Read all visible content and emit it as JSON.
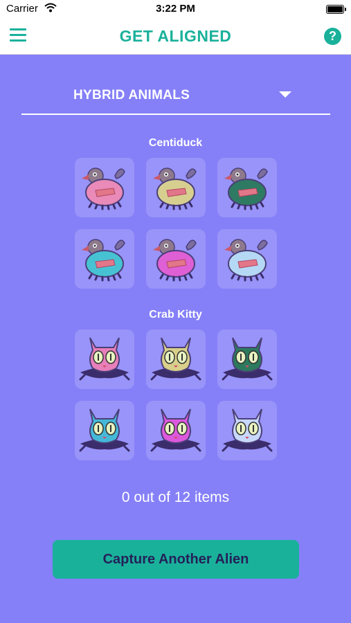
{
  "status_bar": {
    "carrier": "Carrier",
    "time": "3:22 PM"
  },
  "header": {
    "title": "GET ALIGNED",
    "menu_icon": "hamburger-menu-icon",
    "help_icon": "question-circle-icon",
    "help_glyph": "?"
  },
  "category_select": {
    "selected": "HYBRID ANIMALS"
  },
  "groups": [
    {
      "title": "Centiduck",
      "items": [
        {
          "kind": "duck",
          "color": "#e98ab8"
        },
        {
          "kind": "duck",
          "color": "#d7cf90"
        },
        {
          "kind": "duck",
          "color": "#2f7a62"
        },
        {
          "kind": "duck",
          "color": "#47c2d3"
        },
        {
          "kind": "duck",
          "color": "#df5fd5"
        },
        {
          "kind": "duck",
          "color": "#b5d8f5"
        }
      ]
    },
    {
      "title": "Crab Kitty",
      "items": [
        {
          "kind": "cat",
          "color": "#e77fba"
        },
        {
          "kind": "cat",
          "color": "#d8cf8a"
        },
        {
          "kind": "cat",
          "color": "#2c7a5e"
        },
        {
          "kind": "cat",
          "color": "#45b8d8"
        },
        {
          "kind": "cat",
          "color": "#dc58dd"
        },
        {
          "kind": "cat",
          "color": "#c8d8fb"
        }
      ]
    }
  ],
  "progress_text": "0 out of 12 items",
  "capture_button": "Capture Another Alien",
  "colors": {
    "accent": "#1ab19b",
    "background": "#8580f8",
    "button_text": "#232258"
  }
}
